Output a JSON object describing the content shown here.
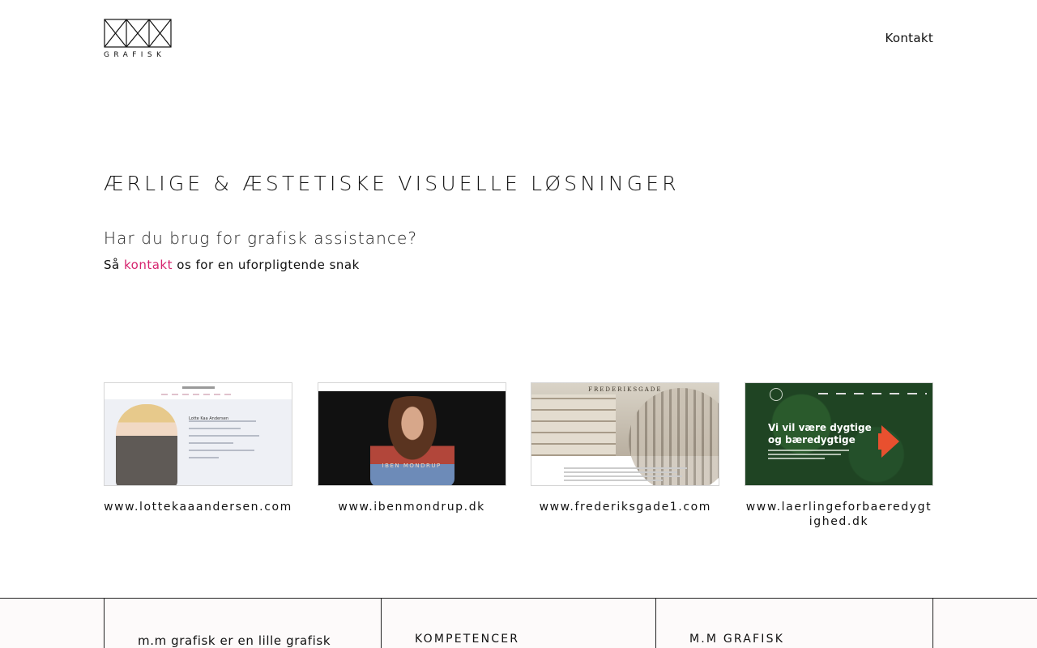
{
  "header": {
    "logo_text": "GRAFISK",
    "nav_contact": "Kontakt"
  },
  "hero": {
    "title": "ÆRLIGE & ÆSTETISKE VISUELLE LØSNINGER",
    "subtitle": "Har du brug for grafisk assistance?",
    "line_prefix": "Så",
    "line_link": "kontakt",
    "line_suffix": "os for en uforpligtende snak"
  },
  "projects": [
    {
      "url": "www.lottekaaandersen.com",
      "thumb_name": "Lotte Kaa Andersen"
    },
    {
      "url": "www.ibenmondrup.dk",
      "thumb_name": "IBEN MONDRUP"
    },
    {
      "url": "www.frederiksgade1.com",
      "thumb_name": "FREDERIKSGADE"
    },
    {
      "url": "www.laerlingeforbaeredygtighed.dk",
      "thumb_headline_1": "Vi vil være dygtige",
      "thumb_headline_2": "og bæredygtige"
    }
  ],
  "footer": {
    "col1_text": "m.m grafisk er en lille grafisk",
    "col2_heading": "KOMPETENCER",
    "col3_heading": "M.M GRAFISK"
  },
  "colors": {
    "accent_link": "#d6246e",
    "text": "#111111",
    "footer_bg": "#fdfafa"
  }
}
